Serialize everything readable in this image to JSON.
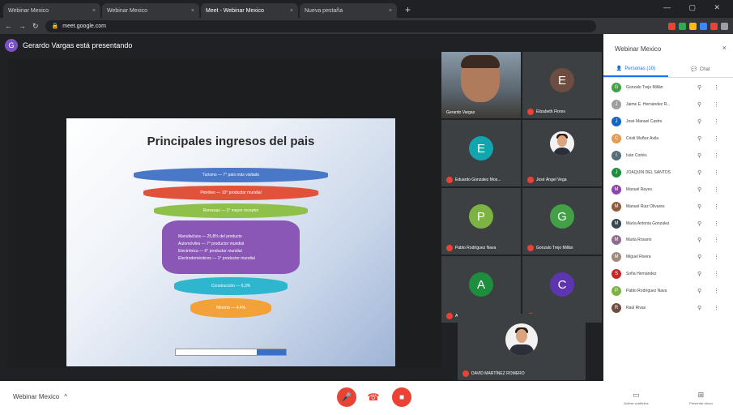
{
  "browser": {
    "tabs": [
      {
        "label": "Webinar Mexico",
        "active": false
      },
      {
        "label": "Webinar Mexico",
        "active": false
      },
      {
        "label": "Meet - Webinar Mexico",
        "active": true
      },
      {
        "label": "Nueva pestaña",
        "active": false
      }
    ],
    "url": "meet.google.com"
  },
  "meeting": {
    "presenter_initial": "G",
    "presenter_text": "Gerardo Vargas está presentando",
    "slide": {
      "title": "Principales ingresos del pais",
      "bands": [
        "Turismo — 7° país más visitado",
        "Petróleo — 10° productor mundial",
        "Remesas — 3° mayor receptor",
        "Manufactura — 25,8% del producto",
        "Automóviles — 7° productor mundial",
        "Electrónica — 6° productor mundial",
        "Electrodomésticos — 1° productor mundial",
        "Construcción — 6,3%",
        "Minería — 4,4%"
      ]
    },
    "tiles": [
      {
        "name": "Gerardo Vargas",
        "type": "camera"
      },
      {
        "name": "Elizabeth Flores",
        "initial": "E",
        "color": "#6d4c41",
        "type": "initial"
      },
      {
        "name": "Eduardo Gonzalez Mos...",
        "initial": "E",
        "color": "#12a4af",
        "type": "initial"
      },
      {
        "name": "José Ángel Vega",
        "type": "photo"
      },
      {
        "name": "Pablo Rodríguez Nava",
        "initial": "P",
        "color": "#7cb342",
        "type": "initial"
      },
      {
        "name": "Gonzalo Trejo Millán",
        "initial": "G",
        "color": "#43a047",
        "type": "initial"
      },
      {
        "name": "Ana Gómez",
        "initial": "A",
        "color": "#1e8e3e",
        "type": "initial"
      },
      {
        "name": "Carlos Suárez",
        "initial": "C",
        "color": "#5e35b1",
        "type": "initial"
      }
    ],
    "self_tile": {
      "name": "DAVID MARTÍNEZ ROMERO"
    },
    "meeting_name": "Webinar Mexico",
    "meeting_name_chevron": "^",
    "controls": {
      "mic_icon": "mic-off-icon",
      "end_icon": "hang-up-icon",
      "cam_icon": "camera-off-icon"
    }
  },
  "panel": {
    "title": "Webinar Mexico",
    "close": "×",
    "tabs": [
      {
        "label": "Personas (10)",
        "active": true
      },
      {
        "label": "Chat",
        "active": false
      }
    ],
    "participants": [
      {
        "name": "Gonzalo Trejo Millán",
        "initial": "G",
        "color": "#43a047"
      },
      {
        "name": "Jaime E. Hernández R...",
        "initial": "J",
        "color": "#9e9e9e"
      },
      {
        "name": "José Manuel Castro",
        "initial": "J",
        "color": "#1565c0"
      },
      {
        "name": "Cristi Muñoz Ávila",
        "initial": "C",
        "color": "#e69b55"
      },
      {
        "name": "Iván Cortés",
        "initial": "I",
        "color": "#546e7a"
      },
      {
        "name": "JOAQUÍN DEL SANTOS",
        "initial": "J",
        "color": "#1e8e3e"
      },
      {
        "name": "Manuel Reyes",
        "initial": "M",
        "color": "#8e44ad"
      },
      {
        "name": "Manuel Ruiz Olivares",
        "initial": "M",
        "color": "#8d5a3c"
      },
      {
        "name": "María Antonia Gonzalez",
        "initial": "M",
        "color": "#37474f"
      },
      {
        "name": "Marta Rosario",
        "initial": "M",
        "color": "#8e6e8e"
      },
      {
        "name": "Miguel Rivera",
        "initial": "M",
        "color": "#a1887f"
      },
      {
        "name": "Sofía Hernández",
        "initial": "S",
        "color": "#c62828"
      },
      {
        "name": "Pablo Rodríguez Nava",
        "initial": "P",
        "color": "#7cb342"
      },
      {
        "name": "Raúl Rivas",
        "initial": "R",
        "color": "#6d4c41"
      }
    ],
    "pin": "⚲",
    "more": "⋮",
    "bottom": [
      {
        "label": "Activar subtítulos",
        "icon": "cc-icon"
      },
      {
        "label": "Presentar ahora",
        "icon": "present-icon"
      }
    ]
  }
}
